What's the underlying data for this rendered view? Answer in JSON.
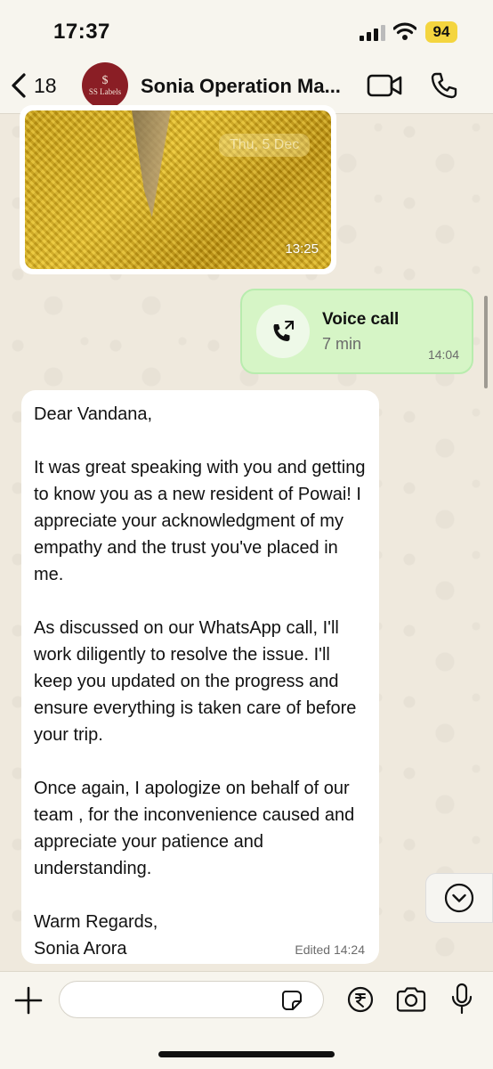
{
  "status_bar": {
    "time": "17:37",
    "battery": "94"
  },
  "header": {
    "back_count": "18",
    "avatar_mark": "$",
    "avatar_text": "SS Labels",
    "contact_name": "Sonia Operation Ma..."
  },
  "messages": {
    "image": {
      "date_chip": "Thu, 5 Dec",
      "time": "13:25"
    },
    "voice_call": {
      "title": "Voice call",
      "duration": "7 min",
      "time": "14:04"
    },
    "text": {
      "paragraphs": [
        "Dear Vandana,",
        "It was great speaking with you and getting to know you as a new resident of Powai! I appreciate your acknowledgment of my empathy and the trust you've placed in me.",
        "As discussed on our WhatsApp call, I'll work diligently to resolve the issue. I'll keep you updated on the progress and ensure everything is taken care of before your trip.",
        "Once again, I apologize on behalf of our team , for the inconvenience caused and appreciate your patience and understanding.",
        "Warm Regards,",
        "Sonia Arora"
      ],
      "edited_label": "Edited",
      "time": "14:24"
    }
  },
  "input": {
    "value": "",
    "placeholder": ""
  },
  "icons": {
    "back": "chevron-left-icon",
    "video": "video-call-icon",
    "phone": "phone-icon",
    "call": "outgoing-call-icon",
    "scroll_down": "chevron-down-icon",
    "plus": "plus-icon",
    "sticker": "sticker-icon",
    "rupee": "rupee-icon",
    "camera": "camera-icon",
    "mic": "microphone-icon"
  },
  "colors": {
    "chat_background": "#efe9dd",
    "outgoing_bubble": "#d6f5c6",
    "incoming_bubble": "#ffffff",
    "battery_badge": "#f4d53f",
    "avatar": "#8a1e25"
  }
}
